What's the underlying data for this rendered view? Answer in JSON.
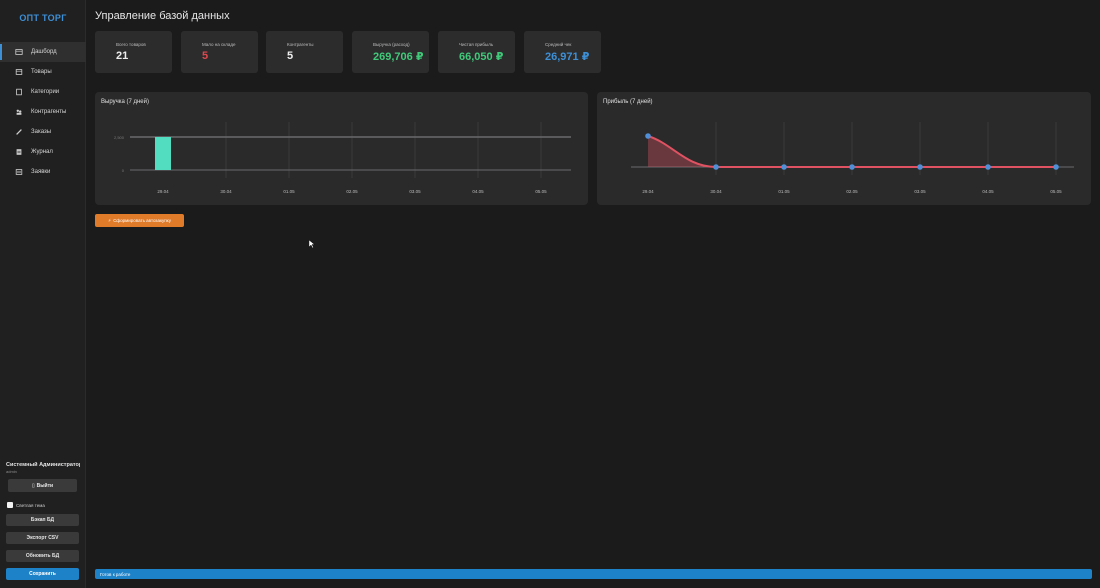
{
  "app": {
    "logo": "ОПТ ТОРГ",
    "page_title": "Управление базой данных"
  },
  "sidebar": {
    "items": [
      {
        "label": "Дашборд",
        "icon": "dashboard-icon",
        "active": true
      },
      {
        "label": "Товары",
        "icon": "box-icon",
        "active": false
      },
      {
        "label": "Категории",
        "icon": "folder-icon",
        "active": false
      },
      {
        "label": "Контрагенты",
        "icon": "users-icon",
        "active": false
      },
      {
        "label": "Заказы",
        "icon": "pencil-icon",
        "active": false
      },
      {
        "label": "Журнал",
        "icon": "journal-icon",
        "active": false
      },
      {
        "label": "Заявки",
        "icon": "list-icon",
        "active": false
      }
    ],
    "user_name": "Системный Администратор",
    "user_role": "admin",
    "logout_label": "Выйти",
    "theme_label": "Светлая тема",
    "backup_label": "Бэкап БД",
    "export_label": "Экспорт CSV",
    "refresh_label": "Обновить БД",
    "save_label": "Сохранить"
  },
  "stats": [
    {
      "label": "Всего товаров",
      "value": "21",
      "color": "#eeeeee"
    },
    {
      "label": "Мало на складе",
      "value": "5",
      "color": "#e0484e"
    },
    {
      "label": "Контрагенты",
      "value": "5",
      "color": "#eeeeee"
    },
    {
      "label": "Выручка (расход)",
      "value": "269,706 ₽",
      "color": "#41c97a"
    },
    {
      "label": "Чистая прибыль",
      "value": "66,050 ₽",
      "color": "#41c97a"
    },
    {
      "label": "Средний чек",
      "value": "26,971 ₽",
      "color": "#3d8fd6"
    }
  ],
  "charts": {
    "revenue_title": "Выручка (7 дней)",
    "profit_title": "Прибыль (7 дней)"
  },
  "chart_data": [
    {
      "type": "bar",
      "title": "Выручка (7 дней)",
      "categories": [
        "29.04",
        "30.04",
        "01.05",
        "02.05",
        "03.05",
        "04.05",
        "05.05"
      ],
      "values": [
        269706,
        0,
        0,
        0,
        0,
        0,
        0
      ],
      "y_tick_labels": [
        "2,500",
        "0"
      ],
      "color": "#52dcc0",
      "grid": true
    },
    {
      "type": "area",
      "title": "Прибыль (7 дней)",
      "categories": [
        "29.04",
        "30.04",
        "01.05",
        "02.05",
        "03.05",
        "04.05",
        "05.05"
      ],
      "values": [
        66050,
        0,
        0,
        0,
        0,
        0,
        0
      ],
      "color": "#e05262",
      "point_color": "#4f8fd8",
      "grid": true
    }
  ],
  "actions": {
    "report_label": "Сформировать автозакупку",
    "report_icon": "bolt-icon"
  },
  "status": {
    "text": "Готов к работе"
  }
}
